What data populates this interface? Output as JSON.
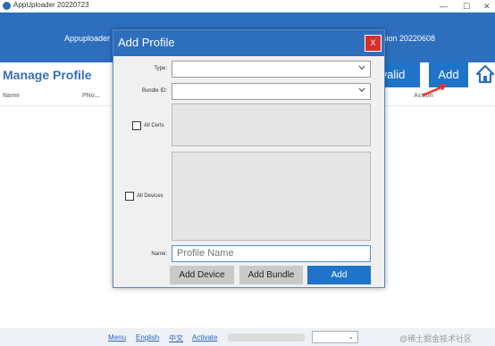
{
  "window": {
    "title": "AppUploader 20220723",
    "minimize_glyph": "—",
    "maximize_glyph": "☐",
    "close_glyph": "✕"
  },
  "header": {
    "left_text": "Appuploader",
    "right_text": "sion 20220608"
  },
  "page": {
    "title": "Manage Profile",
    "invalid_button": "valid",
    "add_button": "Add",
    "home_icon": "home-icon"
  },
  "table": {
    "columns": [
      "Name",
      "PNo...",
      "Action"
    ]
  },
  "modal": {
    "title": "Add Profile",
    "close_label": "X",
    "type_label": "Type:",
    "bundle_label": "Bundle ID:",
    "all_certs_label": "All Certs",
    "all_devices_label": "All Devices",
    "name_label": "Name:",
    "name_placeholder": "Profile Name",
    "type_value": "",
    "bundle_value": "",
    "add_device_button": "Add Device",
    "add_bundle_button": "Add Bundle",
    "add_button": "Add"
  },
  "footer": {
    "links": [
      "Menu",
      "English",
      "中文",
      "Activate"
    ],
    "select_value": "",
    "watermark": "@稀土掘金技术社区"
  },
  "colors": {
    "primary_blue": "#2d6fbd",
    "button_blue": "#1f73c9",
    "close_red": "#d9302b",
    "arrow_red": "#e8332a"
  }
}
